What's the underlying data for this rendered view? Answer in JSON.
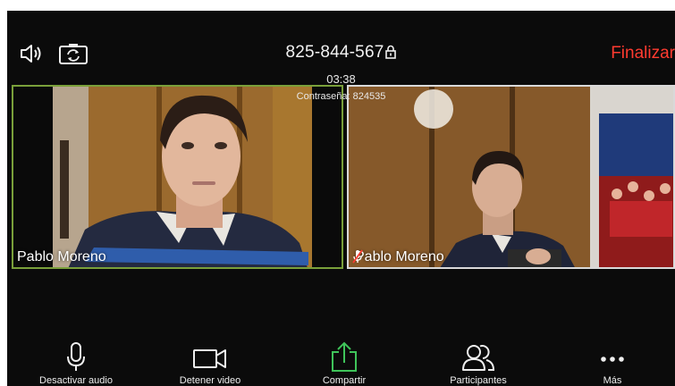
{
  "header": {
    "meeting_id": "825-844-567",
    "end_label": "Finalizar",
    "timer": "03:38",
    "password": "Contraseña: 824535"
  },
  "videos": [
    {
      "name": "Pablo Moreno",
      "active_speaker": true,
      "muted": false
    },
    {
      "name": "Pablo Moreno",
      "active_speaker": false,
      "muted": true
    }
  ],
  "toolbar": {
    "audio_label": "Desactivar audio",
    "video_label": "Detener video",
    "share_label": "Compartir",
    "participants_label": "Participantes",
    "more_label": "Más"
  },
  "colors": {
    "end": "#ff3b30",
    "share_icon": "#3fc45a",
    "active_border": "#7aa03a",
    "background": "#0b0b0b"
  },
  "icons": [
    "speaker-icon",
    "camera-switch-icon",
    "lock-icon",
    "mic-icon",
    "video-camera-icon",
    "share-icon",
    "participants-icon",
    "more-icon",
    "mic-muted-icon"
  ]
}
